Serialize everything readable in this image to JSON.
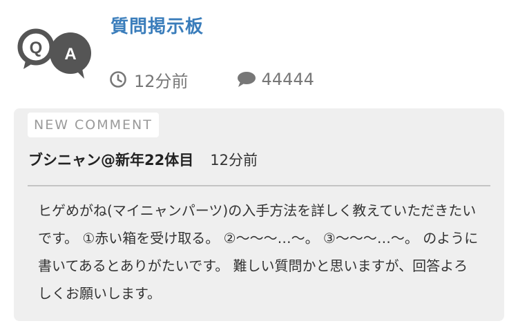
{
  "board": {
    "logo_q": "Q",
    "logo_a": "A",
    "title": "質問掲示板",
    "time_ago": "12分前",
    "comment_count": "44444",
    "icons": {
      "time": "clock-icon",
      "comments": "speech-bubble-icon"
    },
    "colors": {
      "title": "#3a7dbb",
      "logo": "#555555",
      "meta": "#777777"
    }
  },
  "latest_comment": {
    "badge": "NEW COMMENT",
    "author": "ブシニャン@新年22体目",
    "time_ago": "12分前",
    "body": "ヒゲめがね(マイニャンパーツ)の入手方法を詳しく教えていただきたいです。 ①赤い箱を受け取る。 ②〜〜〜…〜。 ③〜〜〜…〜。 のように書いてあるとありがたいです。 難しい質問かと思いますが、回答よろしくお願いします。",
    "colors": {
      "card_background": "#efefef",
      "badge_text": "#9a9a9a"
    }
  }
}
